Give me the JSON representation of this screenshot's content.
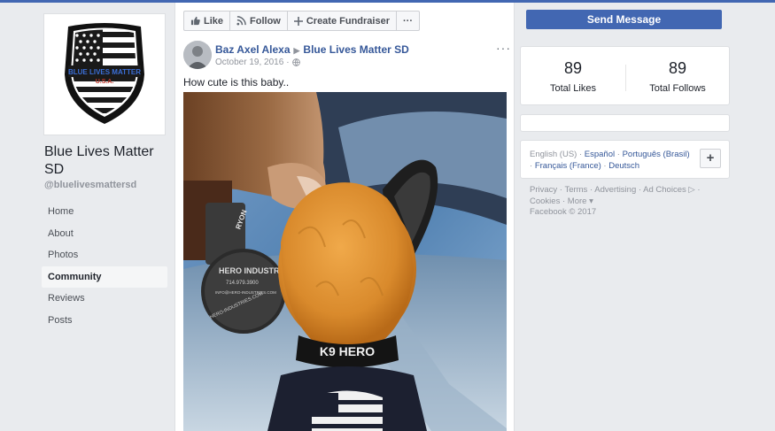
{
  "page": {
    "name": "Blue Lives Matter SD",
    "handle": "@bluelivesmattersd",
    "logo_text_main": "BLUE LIVES MATTER",
    "logo_text_sub": "U.S.A."
  },
  "nav": {
    "items": [
      {
        "label": "Home"
      },
      {
        "label": "About"
      },
      {
        "label": "Photos"
      },
      {
        "label": "Community",
        "active": true
      },
      {
        "label": "Reviews"
      },
      {
        "label": "Posts"
      }
    ]
  },
  "actions": {
    "like": "Like",
    "follow": "Follow",
    "fundraiser": "Create Fundraiser",
    "more": "···"
  },
  "post": {
    "author": "Baz Axel Alexa",
    "target_page": "Blue Lives Matter SD",
    "date": "October 19, 2016",
    "text": "How cute is this baby..",
    "more": "···",
    "photo_texts": {
      "collar": "K9 HERO",
      "tag_brand": "HERO INDUSTRIES",
      "tag_phone": "714.979.3900",
      "tag_email": "INFO@HERO-INDUSTRIES.COM",
      "tag_url": "HERO-INDUSTRIES.COM",
      "tag_top": "RYON"
    }
  },
  "right": {
    "send_message": "Send Message",
    "likes_count": "89",
    "likes_label": "Total Likes",
    "follows_count": "89",
    "follows_label": "Total Follows",
    "lang_current": "English (US)",
    "languages": [
      "Español",
      "Português (Brasil)",
      "Français (France)",
      "Deutsch"
    ],
    "plus": "+"
  },
  "footer": {
    "privacy": "Privacy",
    "terms": "Terms",
    "advertising": "Advertising",
    "ad_choices": "Ad Choices",
    "cookies": "Cookies",
    "more": "More",
    "copyright": "Facebook © 2017"
  },
  "colors": {
    "brand_blue": "#4267b2",
    "link_blue": "#365899",
    "background": "#e9ebee"
  }
}
